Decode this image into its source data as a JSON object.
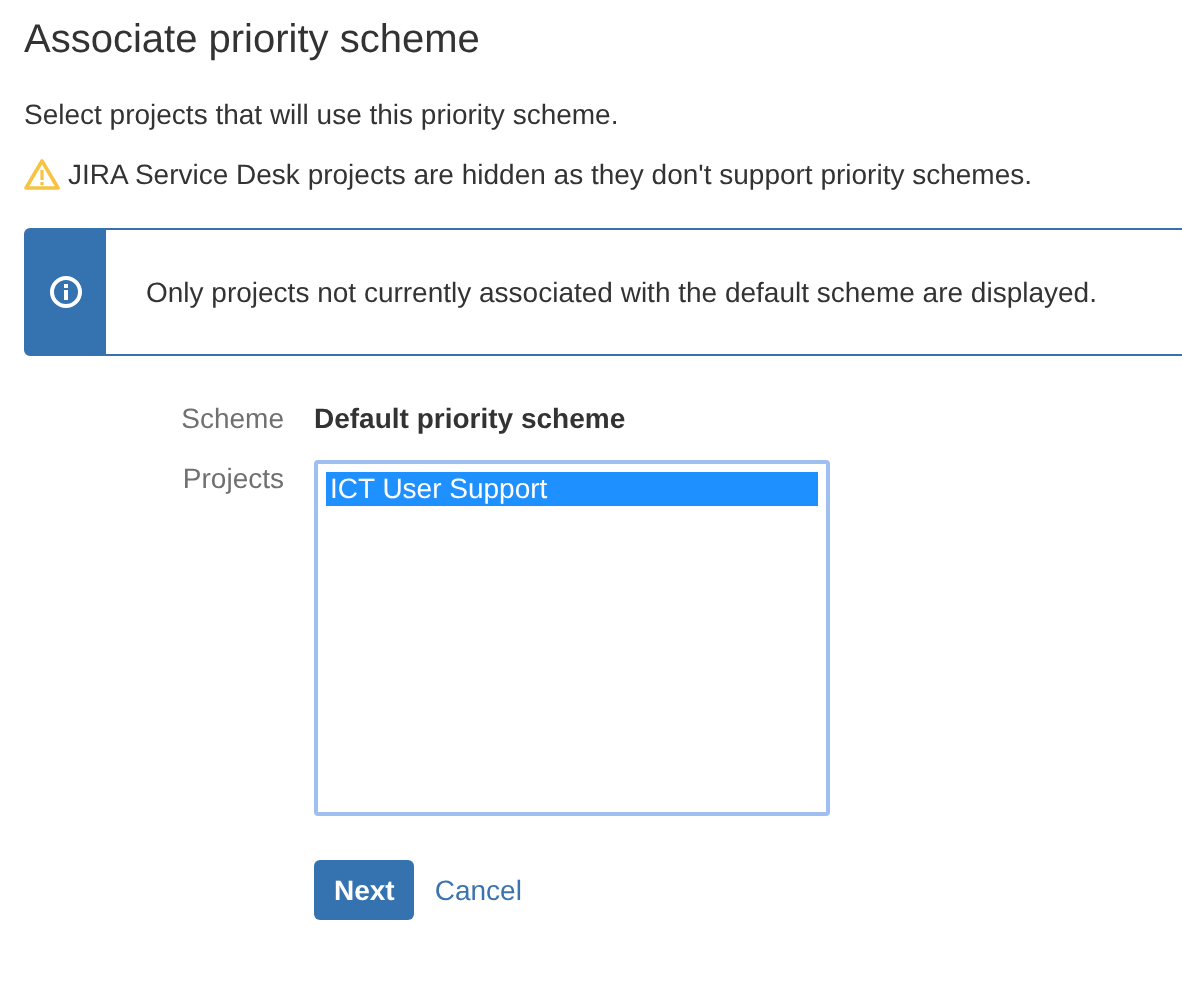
{
  "title": "Associate priority scheme",
  "description": "Select projects that will use this priority scheme.",
  "warning": "JIRA Service Desk projects are hidden as they don't support priority schemes.",
  "info_message": "Only projects not currently associated with the default scheme are displayed.",
  "form": {
    "scheme_label": "Scheme",
    "scheme_value": "Default priority scheme",
    "projects_label": "Projects",
    "projects": [
      {
        "name": "ICT User Support",
        "selected": true
      }
    ]
  },
  "buttons": {
    "next": "Next",
    "cancel": "Cancel"
  }
}
